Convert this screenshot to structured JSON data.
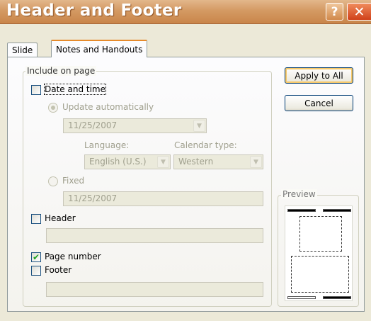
{
  "window": {
    "title": "Header and Footer",
    "help_glyph": "?",
    "close_glyph": "✕"
  },
  "tabs": [
    {
      "label": "Slide",
      "active": false
    },
    {
      "label": "Notes and Handouts",
      "active": true
    }
  ],
  "include_group": {
    "legend": "Include on page",
    "date_time": {
      "label": "Date and time",
      "checked": false
    },
    "update_automatically": {
      "label": "Update automatically",
      "selected": true,
      "date_value": "11/25/2007"
    },
    "language": {
      "label": "Language:",
      "value": "English (U.S.)"
    },
    "calendar_type": {
      "label": "Calendar type:",
      "value": "Western"
    },
    "fixed": {
      "label": "Fixed",
      "selected": false,
      "value": "11/25/2007"
    },
    "header": {
      "label": "Header",
      "checked": false,
      "value": ""
    },
    "page_number": {
      "label": "Page number",
      "checked": true
    },
    "footer": {
      "label": "Footer",
      "checked": false,
      "value": ""
    }
  },
  "buttons": {
    "apply_to_all": "Apply to All",
    "cancel": "Cancel"
  },
  "preview": {
    "legend": "Preview"
  },
  "icons": {
    "check": "✔",
    "dropdown": "▼"
  },
  "colors": {
    "titlebar": "#d49a63",
    "active_tab_accent": "#e68b2c",
    "check_green": "#21a121"
  }
}
